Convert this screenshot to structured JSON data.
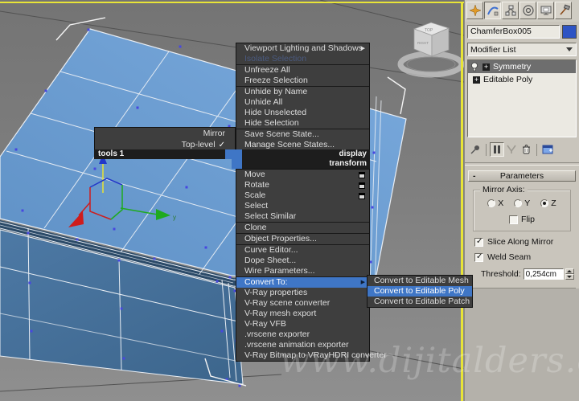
{
  "watermark": "www.dijitalders.com",
  "glyphs": {
    "check": "✓",
    "plus": "+",
    "submenu_arrow": "▶",
    "collapse": "-"
  },
  "colors": {
    "accent_blue": "#3f76c6",
    "object_color": "#2e54c4",
    "viewport_active_border": "#e8e437",
    "box_top_face": "#6fa3d8",
    "box_front_face": "#4a74a0"
  },
  "viewport": {
    "viewcube": {
      "top_label": "TOP",
      "side_label": "RIGHT"
    },
    "gizmo_axis_label": "y"
  },
  "quad_menu": {
    "tools_quad": {
      "header": "tools 1",
      "items": [
        {
          "label": "Mirror"
        },
        {
          "label": "Top-level",
          "checked": true
        }
      ]
    },
    "display_header": "display",
    "transform_header": "transform",
    "display_items": [
      {
        "label": "Viewport Lighting and Shadows",
        "has_submenu": true
      },
      {
        "label": "Isolate Selection",
        "disabled": true
      },
      {
        "label": "Unfreeze All"
      },
      {
        "label": "Freeze Selection"
      },
      {
        "label": "Unhide by Name"
      },
      {
        "label": "Unhide All"
      },
      {
        "label": "Hide Unselected"
      },
      {
        "label": "Hide Selection"
      },
      {
        "label": "Save Scene State..."
      },
      {
        "label": "Manage Scene States..."
      }
    ],
    "transform_items": [
      {
        "label": "Move",
        "has_settings": true
      },
      {
        "label": "Rotate",
        "has_settings": true
      },
      {
        "label": "Scale",
        "has_settings": true
      },
      {
        "label": "Select"
      },
      {
        "label": "Select Similar"
      },
      {
        "label": "Clone"
      },
      {
        "label": "Object Properties..."
      },
      {
        "label": "Curve Editor..."
      },
      {
        "label": "Dope Sheet..."
      },
      {
        "label": "Wire Parameters..."
      },
      {
        "label": "Convert To:",
        "has_submenu": true,
        "highlighted": true
      },
      {
        "label": "V-Ray properties"
      },
      {
        "label": "V-Ray scene converter"
      },
      {
        "label": "V-Ray mesh export"
      },
      {
        "label": "V-Ray VFB"
      },
      {
        "label": ".vrscene exporter"
      },
      {
        "label": ".vrscene animation exporter"
      },
      {
        "label": "V-Ray Bitmap to VRayHDRI converter"
      }
    ],
    "convert_submenu": [
      {
        "label": "Convert to Editable Mesh"
      },
      {
        "label": "Convert to Editable Poly",
        "highlighted": true
      },
      {
        "label": "Convert to Editable Patch"
      }
    ]
  },
  "command_panel": {
    "tabs": [
      {
        "name": "create"
      },
      {
        "name": "modify",
        "active": true
      },
      {
        "name": "hierarchy"
      },
      {
        "name": "motion"
      },
      {
        "name": "display"
      },
      {
        "name": "utilities"
      }
    ],
    "object_name": "ChamferBox005",
    "modifier_list_label": "Modifier List",
    "modifier_stack": [
      {
        "label": "Symmetry",
        "selected": true
      },
      {
        "label": "Editable Poly"
      }
    ],
    "parameters": {
      "rollout_title": "Parameters",
      "mirror_axis_label": "Mirror Axis:",
      "axis_options": [
        "X",
        "Y",
        "Z"
      ],
      "axis_selected": "Z",
      "flip_label": "Flip",
      "slice_label": "Slice Along Mirror",
      "slice_checked": true,
      "weld_label": "Weld Seam",
      "weld_checked": true,
      "threshold_label": "Threshold:",
      "threshold_value": "0,254cm"
    }
  }
}
